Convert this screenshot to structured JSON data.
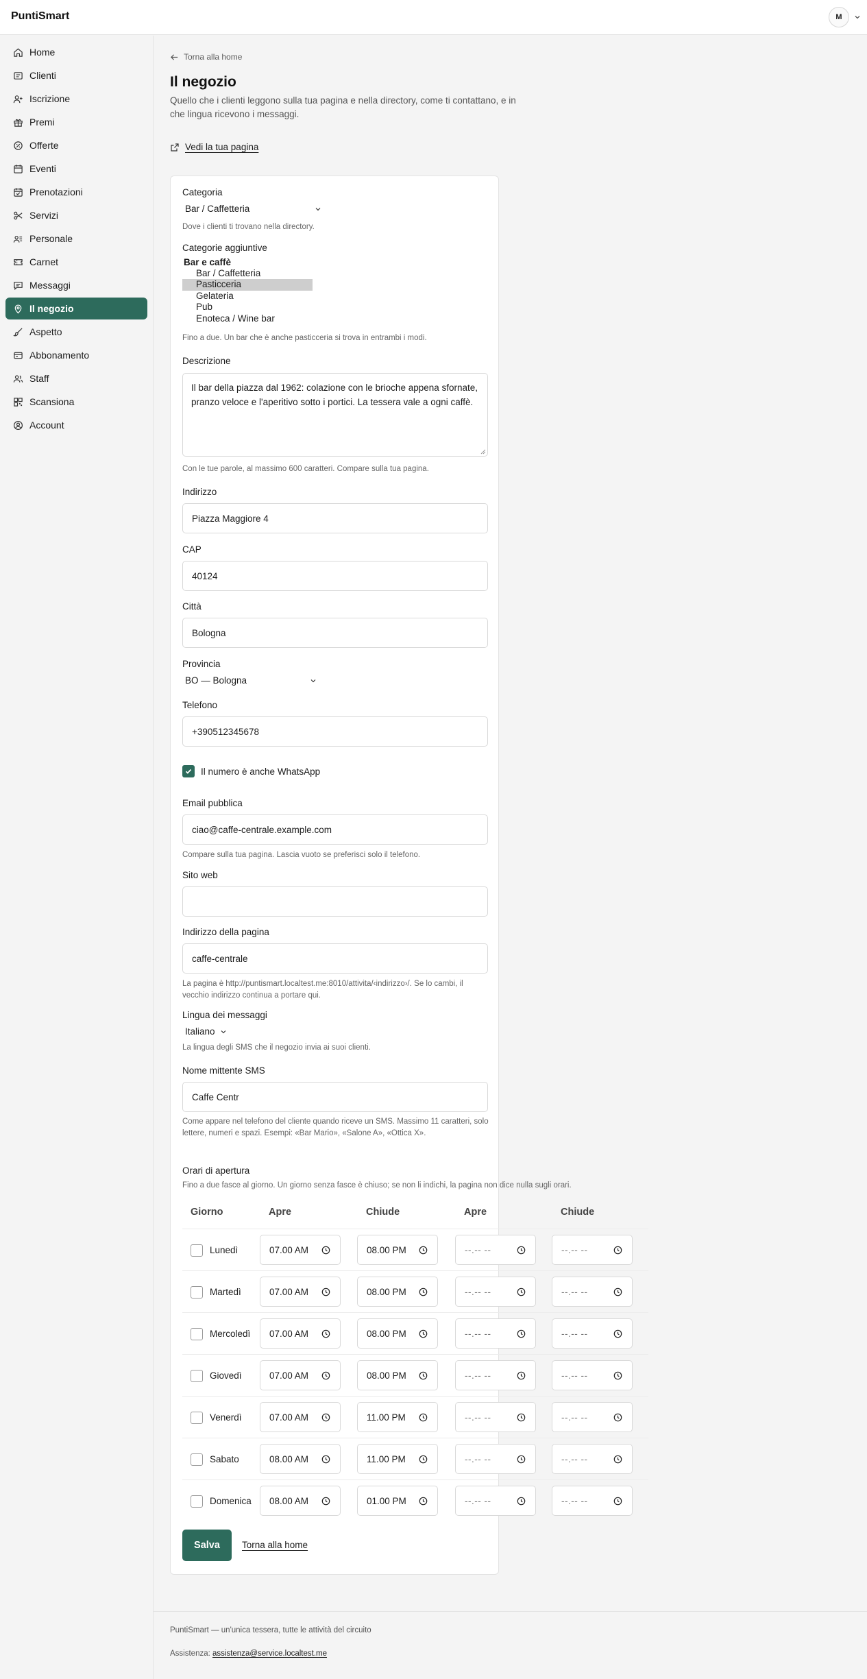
{
  "app": {
    "brand": "PuntiSmart",
    "avatar_initial": "M"
  },
  "sidebar": {
    "items": [
      {
        "label": "Home",
        "icon": "home-icon"
      },
      {
        "label": "Clienti",
        "icon": "id-card-icon"
      },
      {
        "label": "Iscrizione",
        "icon": "user-plus-icon"
      },
      {
        "label": "Premi",
        "icon": "gift-icon"
      },
      {
        "label": "Offerte",
        "icon": "percent-badge-icon"
      },
      {
        "label": "Eventi",
        "icon": "calendar-icon"
      },
      {
        "label": "Prenotazioni",
        "icon": "calendar-check-icon"
      },
      {
        "label": "Servizi",
        "icon": "scissors-icon"
      },
      {
        "label": "Personale",
        "icon": "users-icon"
      },
      {
        "label": "Carnet",
        "icon": "ticket-icon"
      },
      {
        "label": "Messaggi",
        "icon": "message-icon"
      },
      {
        "label": "Il negozio",
        "icon": "map-pin-icon",
        "active": true
      },
      {
        "label": "Aspetto",
        "icon": "brush-icon"
      },
      {
        "label": "Abbonamento",
        "icon": "credit-card-icon"
      },
      {
        "label": "Staff",
        "icon": "team-icon"
      },
      {
        "label": "Scansiona",
        "icon": "qr-code-icon"
      },
      {
        "label": "Account",
        "icon": "account-circle-icon"
      }
    ]
  },
  "header": {
    "back_label": "Torna alla home",
    "title": "Il negozio",
    "intro": "Quello che i clienti leggono sulla tua pagina e nella directory, come ti contattano, e in che lingua ricevono i messaggi.",
    "view_page_label": "Vedi la tua pagina"
  },
  "form": {
    "category": {
      "label": "Categoria",
      "value": "Bar / Caffetteria",
      "hint": "Dove i clienti ti trovano nella directory."
    },
    "extra_categories": {
      "label": "Categorie aggiuntive",
      "group": "Bar e caffè",
      "options": [
        "Bar / Caffetteria",
        "Pasticceria",
        "Gelateria",
        "Pub",
        "Enoteca / Wine bar"
      ],
      "selected": "Pasticceria",
      "hint": "Fino a due. Un bar che è anche pasticceria si trova in entrambi i modi."
    },
    "description": {
      "label": "Descrizione",
      "value": "Il bar della piazza dal 1962: colazione con le brioche appena sfornate, pranzo veloce e l'aperitivo sotto i portici. La tessera vale a ogni caffè.",
      "hint": "Con le tue parole, al massimo 600 caratteri. Compare sulla tua pagina."
    },
    "address": {
      "label": "Indirizzo",
      "value": "Piazza Maggiore 4"
    },
    "cap": {
      "label": "CAP",
      "value": "40124"
    },
    "city": {
      "label": "Città",
      "value": "Bologna"
    },
    "province": {
      "label": "Provincia",
      "value": "BO — Bologna"
    },
    "phone": {
      "label": "Telefono",
      "value": "+390512345678"
    },
    "whatsapp": {
      "label": "Il numero è anche WhatsApp",
      "checked": true
    },
    "email": {
      "label": "Email pubblica",
      "value": "ciao@caffe-centrale.example.com",
      "hint": "Compare sulla tua pagina. Lascia vuoto se preferisci solo il telefono."
    },
    "website": {
      "label": "Sito web",
      "value": ""
    },
    "slug": {
      "label": "Indirizzo della pagina",
      "value": "caffe-centrale",
      "hint": "La pagina è http://puntismart.localtest.me:8010/attivita/‹indirizzo›/. Se lo cambi, il vecchio indirizzo continua a portare qui."
    },
    "language": {
      "label": "Lingua dei messaggi",
      "value": "Italiano",
      "hint": "La lingua degli SMS che il negozio invia ai suoi clienti."
    },
    "sms_sender": {
      "label": "Nome mittente SMS",
      "value": "Caffe Centr",
      "hint": "Come appare nel telefono del cliente quando riceve un SMS. Massimo 11 caratteri, solo lettere, numeri e spazi. Esempi: «Bar Mario», «Salone A», «Ottica X»."
    },
    "hours": {
      "label": "Orari di apertura",
      "hint": "Fino a due fasce al giorno. Un giorno senza fasce è chiuso; se non li indichi, la pagina non dice nulla sugli orari.",
      "headers": [
        "Giorno",
        "Apre",
        "Chiude",
        "Apre",
        "Chiude"
      ],
      "empty_placeholder": "--.-- --",
      "rows": [
        {
          "day": "Lunedì",
          "open1": "07.00 AM",
          "close1": "08.00 PM"
        },
        {
          "day": "Martedì",
          "open1": "07.00 AM",
          "close1": "08.00 PM"
        },
        {
          "day": "Mercoledì",
          "open1": "07.00 AM",
          "close1": "08.00 PM"
        },
        {
          "day": "Giovedì",
          "open1": "07.00 AM",
          "close1": "08.00 PM"
        },
        {
          "day": "Venerdì",
          "open1": "07.00 AM",
          "close1": "11.00 PM"
        },
        {
          "day": "Sabato",
          "open1": "08.00 AM",
          "close1": "11.00 PM"
        },
        {
          "day": "Domenica",
          "open1": "08.00 AM",
          "close1": "01.00 PM"
        }
      ]
    },
    "save_label": "Salva",
    "back_label": "Torna alla home"
  },
  "footer": {
    "tagline": "PuntiSmart — un'unica tessera, tutte le attività del circuito",
    "assist_label": "Assistenza:",
    "assist_email": "assistenza@service.localtest.me"
  },
  "colors": {
    "accent": "#2d6b5c"
  }
}
